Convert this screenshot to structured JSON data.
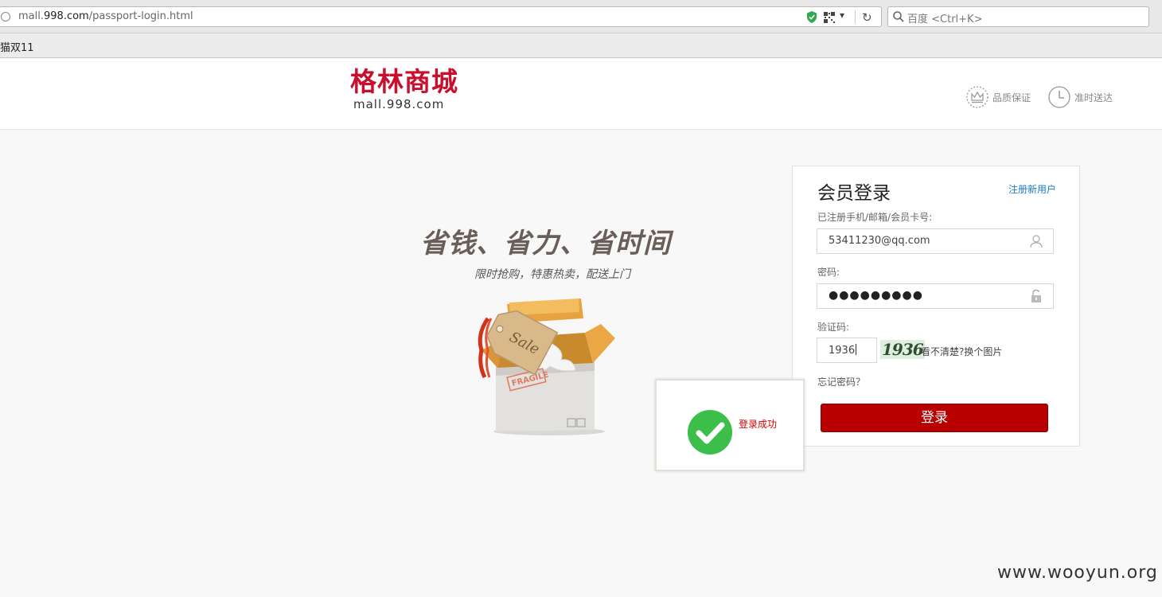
{
  "browser": {
    "url_prefix": "mall.",
    "url_domain": "998.com",
    "url_path": "/passport-login.html",
    "dropdown_glyph": "▾",
    "reload_glyph": "↻",
    "search_placeholder": "百度 <Ctrl+K>",
    "bookmark": "猫双11"
  },
  "header": {
    "logo_cn": "格林商城",
    "logo_en": "mall.998.com",
    "features": [
      {
        "label": "品质保证",
        "icon": "crown-icon"
      },
      {
        "label": "准时送达",
        "icon": "clock-icon"
      }
    ]
  },
  "hero": {
    "slogan": "省钱、省力、省时间",
    "subslogan": "限时抢购，特惠热卖，配送上门",
    "tag_text": "Sale",
    "stamp_text": "FRAGILE"
  },
  "login": {
    "title": "会员登录",
    "register_link": "注册新用户",
    "account_label": "已注册手机/邮箱/会员卡号:",
    "account_value": "53411230@qq.com",
    "password_label": "密码:",
    "password_masked": "●●●●●●●●●",
    "captcha_label": "验证码:",
    "captcha_value": "1936",
    "captcha_image_text": "1936",
    "captcha_refresh": "看不清楚?换个图片",
    "forgot_link": "忘记密码？",
    "submit_label": "登录"
  },
  "toast": {
    "message": "登录成功"
  },
  "watermark": "www.wooyun.org",
  "colors": {
    "brand_red": "#c8102e",
    "button_red": "#b90000",
    "link_blue": "#1a7bc4",
    "success_green": "#3cbf4a"
  }
}
